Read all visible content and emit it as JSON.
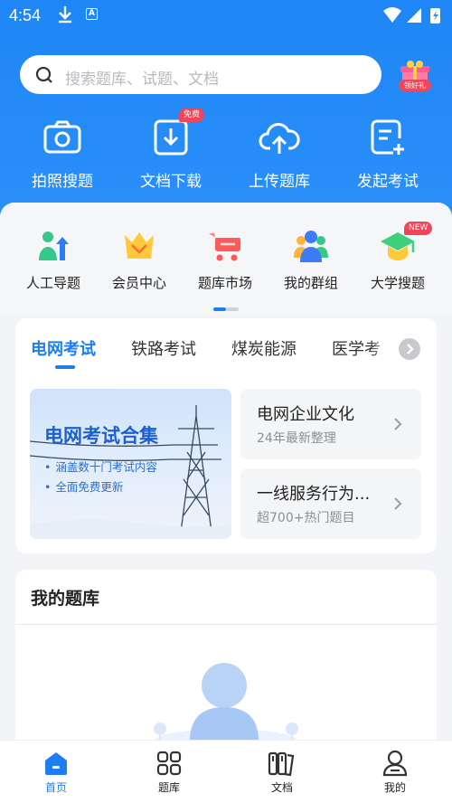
{
  "status_bar": {
    "time": "4:54",
    "notif_icon": "A"
  },
  "search": {
    "placeholder": "搜索题库、试题、文档",
    "gift_label": "领好礼"
  },
  "top_actions": [
    {
      "label": "拍照搜题",
      "icon": "camera-icon"
    },
    {
      "label": "文档下载",
      "icon": "download-doc-icon",
      "badge": "免费"
    },
    {
      "label": "上传题库",
      "icon": "cloud-upload-icon"
    },
    {
      "label": "发起考试",
      "icon": "create-exam-icon"
    }
  ],
  "grid": [
    {
      "label": "人工导题",
      "icon": "manual-import-icon"
    },
    {
      "label": "会员中心",
      "icon": "crown-icon"
    },
    {
      "label": "题库市场",
      "icon": "cart-icon"
    },
    {
      "label": "我的群组",
      "icon": "group-icon"
    },
    {
      "label": "大学搜题",
      "icon": "graduation-cap-icon",
      "badge": "NEW"
    }
  ],
  "exam_tabs": [
    "电网考试",
    "铁路考试",
    "煤炭能源",
    "医学考"
  ],
  "banner": {
    "title": "电网考试合集",
    "lines": [
      "涵盖数十门考试内容",
      "全面免费更新"
    ]
  },
  "info_cards": [
    {
      "title": "电网企业文化",
      "sub": "24年最新整理"
    },
    {
      "title": "一线服务行为...",
      "sub": "超700+热门题目"
    }
  ],
  "my_bank": {
    "title": "我的题库"
  },
  "bottom_nav": [
    {
      "label": "首页",
      "icon": "home-icon",
      "active": true
    },
    {
      "label": "题库",
      "icon": "grid-icon"
    },
    {
      "label": "文档",
      "icon": "books-icon"
    },
    {
      "label": "我的",
      "icon": "user-icon"
    }
  ],
  "colors": {
    "primary": "#1e86f6",
    "accent_red": "#f0465b",
    "text": "#222222"
  }
}
